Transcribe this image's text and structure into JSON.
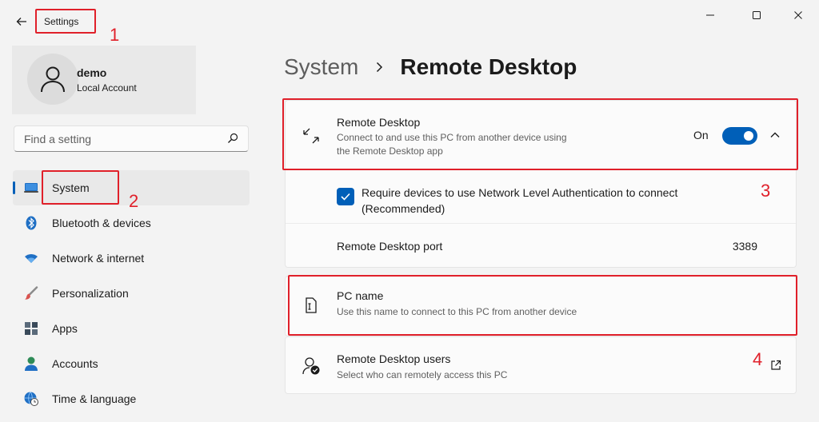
{
  "window": {
    "title": "Settings"
  },
  "account": {
    "name": "demo",
    "type": "Local Account"
  },
  "search": {
    "placeholder": "Find a setting"
  },
  "sidebar": {
    "items": [
      {
        "label": "System",
        "icon": "laptop-icon",
        "active": true
      },
      {
        "label": "Bluetooth & devices",
        "icon": "bluetooth-icon"
      },
      {
        "label": "Network & internet",
        "icon": "wifi-icon"
      },
      {
        "label": "Personalization",
        "icon": "brush-icon"
      },
      {
        "label": "Apps",
        "icon": "apps-icon"
      },
      {
        "label": "Accounts",
        "icon": "person-icon"
      },
      {
        "label": "Time & language",
        "icon": "globe-clock-icon"
      }
    ]
  },
  "breadcrumb": {
    "parent": "System",
    "current": "Remote Desktop"
  },
  "remote_desktop": {
    "title": "Remote Desktop",
    "description_line1": "Connect to and use this PC from another device using",
    "description_line2": "the Remote Desktop app",
    "toggle_label": "On",
    "toggle_on": true,
    "nla_label_line1": "Require devices to use Network Level Authentication to connect",
    "nla_label_line2": "(Recommended)",
    "nla_checked": true,
    "port_label": "Remote Desktop port",
    "port_value": "3389"
  },
  "pc_name": {
    "title": "PC name",
    "description": "Use this name to connect to this PC from another device"
  },
  "rd_users": {
    "title": "Remote Desktop users",
    "description": "Select who can remotely access this PC"
  },
  "annotations": [
    "1",
    "2",
    "3",
    "4"
  ],
  "colors": {
    "accent": "#005fb8",
    "annotation": "#e0202a",
    "background": "#f3f3f3",
    "card": "#fbfbfb"
  }
}
